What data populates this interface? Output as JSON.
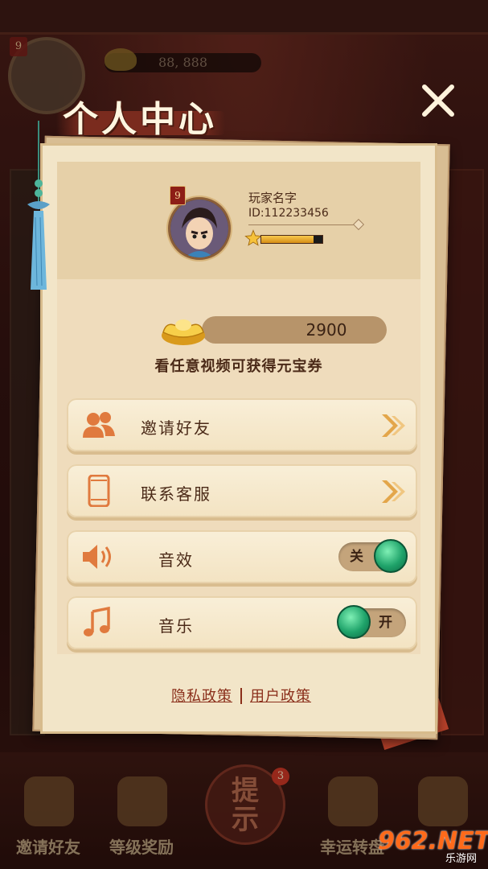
{
  "background": {
    "coin_amount": "88, 888",
    "level": "9",
    "hint_label": "提\n示",
    "hint_badge": "3",
    "bottom_nav": [
      "邀请好友",
      "等级奖励",
      "",
      "幸运转盘",
      ""
    ],
    "watermark": {
      "logo": "962.NET",
      "sub": "乐游网"
    }
  },
  "dialog": {
    "title": "个人中心",
    "close_icon": "close-icon",
    "profile": {
      "level": "9",
      "name": "玩家名字",
      "id": "ID:112233456",
      "xp_progress": 0.85
    },
    "currency": {
      "value": "2900",
      "description": "看任意视频可获得元宝券"
    },
    "menu": [
      {
        "label": "邀请好友",
        "icon": "users-icon",
        "type": "link"
      },
      {
        "label": "联系客服",
        "icon": "phone-icon",
        "type": "link"
      },
      {
        "label": "音效",
        "icon": "speaker-icon",
        "type": "toggle",
        "state_text": "关",
        "on": false
      },
      {
        "label": "音乐",
        "icon": "music-note-icon",
        "type": "toggle",
        "state_text": "开",
        "on": true
      }
    ],
    "footer": {
      "privacy": "隐私政策",
      "user_policy": "用户政策"
    }
  },
  "colors": {
    "accent_red": "#8a2e1a",
    "paper": "#f2e5c8",
    "toggle_green": "#1fa36a",
    "icon_orange": "#e07a3e"
  }
}
